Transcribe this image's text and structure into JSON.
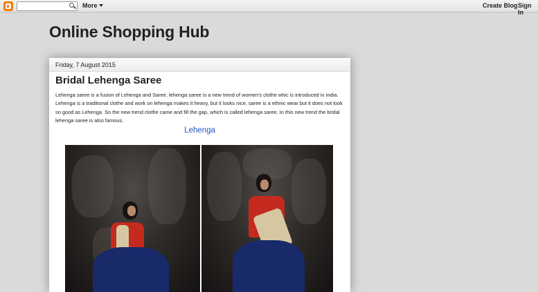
{
  "navbar": {
    "logo_icon": "blogger-icon",
    "search_placeholder": "",
    "more_label": "More",
    "create_blog_label": "Create Blog",
    "sign_in_label": "Sign In"
  },
  "blog": {
    "title": "Online Shopping Hub"
  },
  "post": {
    "date": "Friday, 7 August 2015",
    "title": "Bridal Lehenga Saree",
    "body": "Lehenga saree is a fusion of Lehenga and Saree, lehenga saree is a new trend of women's clothe whic is introduced in India. Lehenga is a traditional clothe and work on lehenga makes it heavy, but it looks nice, saree is a ethnic wear but it does not look so good as Lehenga. So the new trend clothe came and fill the gap, which is called lehenga saree. In this new trend the bridal lehenga saree is also famous.",
    "subheading": "Lehenga"
  },
  "colors": {
    "accent_link": "#2255bb",
    "blogger_orange": "#f57d00",
    "page_bg": "#dadada"
  }
}
